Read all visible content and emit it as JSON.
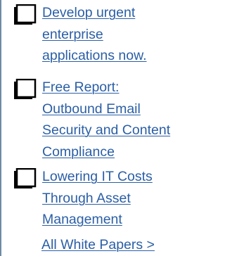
{
  "white_papers": {
    "icon": "document-icon",
    "link_color": "#2b5fa6",
    "items": [
      {
        "lines": [
          "Develop urgent",
          "enterprise",
          "applications now."
        ]
      },
      {
        "lines": [
          "Free Report:",
          "Outbound Email",
          "Security and Content",
          "Compliance"
        ]
      },
      {
        "lines": [
          "Lowering IT Costs",
          "Through Asset",
          "Management"
        ]
      }
    ],
    "all_link": "All White Papers >"
  }
}
